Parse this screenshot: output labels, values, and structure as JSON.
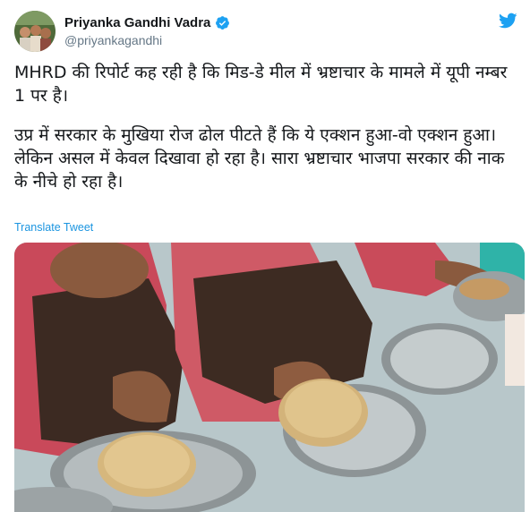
{
  "tweet": {
    "author": {
      "display_name": "Priyanka Gandhi Vadra",
      "handle": "@priyankagandhi",
      "verified": true,
      "verified_icon": "verified-badge-icon"
    },
    "text_paragraphs": [
      "MHRD की रिपोर्ट कह रही है कि मिड-डे मील में भ्रष्टाचार के मामले में यूपी नम्बर 1 पर है।",
      "उप्र में सरकार के मुखिया रोज ढोल पीटते हैं कि ये एक्शन हुआ-वो एक्शन हुआ। लेकिन असल में केवल दिखावा हो रहा है। सारा भ्रष्टाचार भाजपा सरकार की नाक के नीचे हो रहा है।"
    ],
    "translate_label": "Translate Tweet",
    "platform_icon": "twitter-bird-icon",
    "media": {
      "type": "photo",
      "description_icon": "media-photo"
    }
  },
  "colors": {
    "link_blue": "#1b95e0",
    "text_primary": "#14171a",
    "text_secondary": "#657786",
    "verified_blue": "#1da1f2"
  }
}
